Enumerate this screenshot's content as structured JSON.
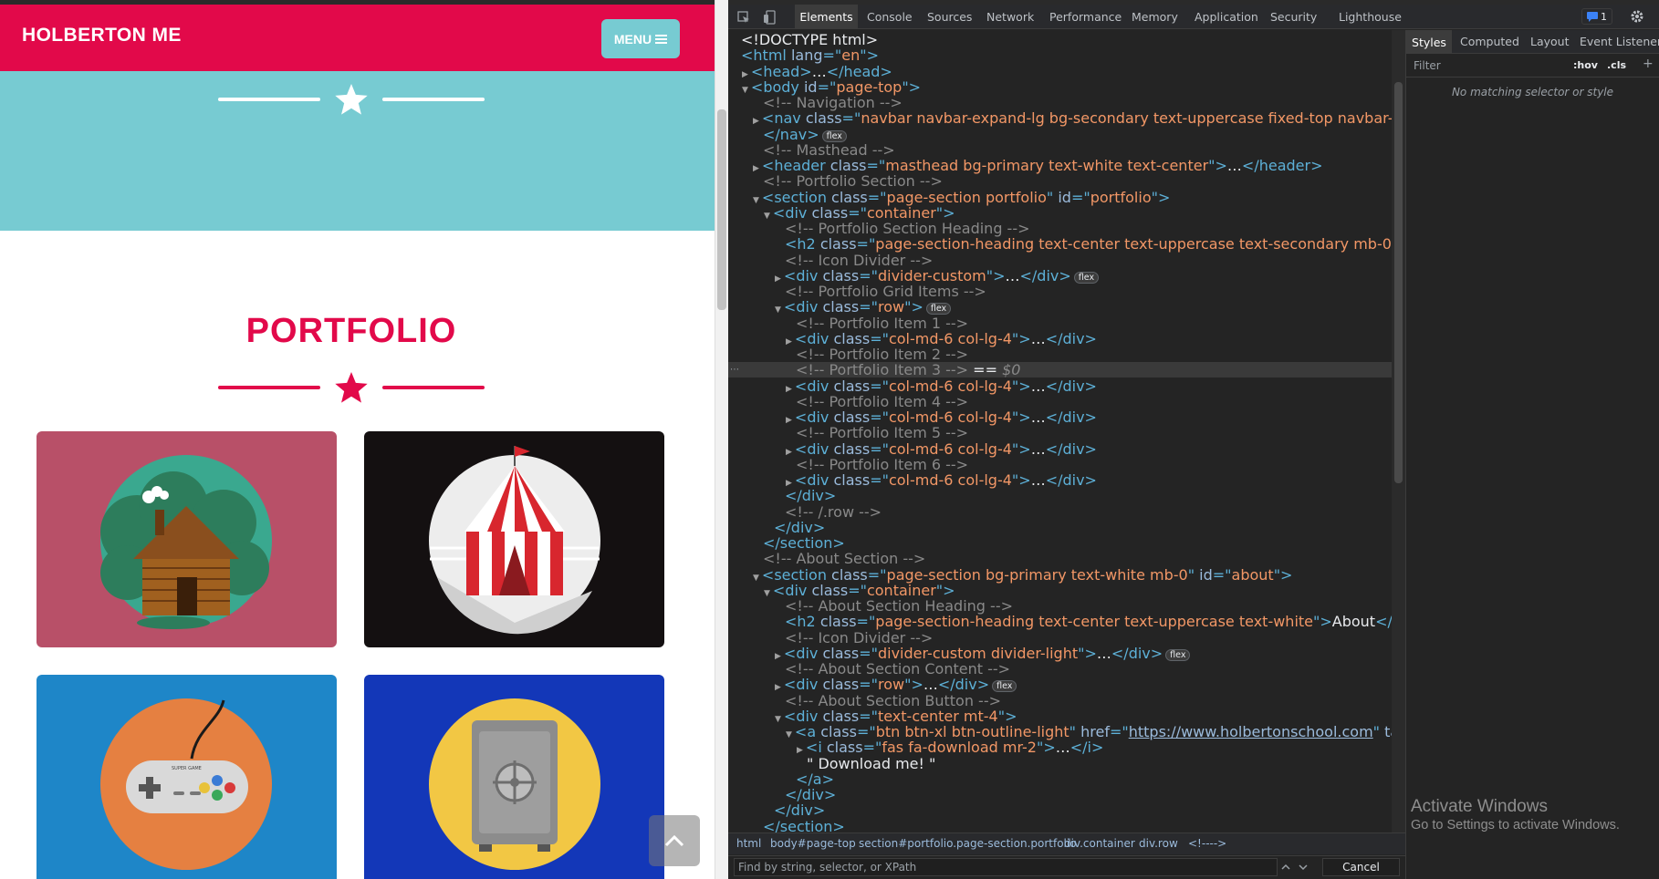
{
  "site": {
    "brand": "HOLBERTON ME",
    "menu_label": "MENU",
    "portfolio_heading": "PORTFOLIO",
    "colors": {
      "primary": "#e2094a",
      "secondary": "#77cbd2"
    },
    "tiles": [
      {
        "name": "cabin",
        "bg": "#b85068",
        "circle": "#3aa88f"
      },
      {
        "name": "circus-tent",
        "bg": "#141011",
        "circle": "#ededed"
      },
      {
        "name": "game-controller",
        "bg": "#1e86c8",
        "circle": "#e58041"
      },
      {
        "name": "safe",
        "bg": "#1337b8",
        "circle": "#f2c744"
      }
    ],
    "controller_text": "SUPER GAME"
  },
  "devtools": {
    "tabs": [
      "Elements",
      "Console",
      "Sources",
      "Network",
      "Performance",
      "Memory",
      "Application",
      "Security",
      "Lighthouse"
    ],
    "issues_count": "1",
    "code_lines": [
      [
        {
          "c": "t-txt",
          "t": "<!DOCTYPE html>"
        }
      ],
      [
        {
          "c": "t-tag",
          "t": "<html "
        },
        {
          "c": "t-attr",
          "t": "lang"
        },
        {
          "c": "t-tag",
          "t": "=\""
        },
        {
          "c": "t-val",
          "t": "en"
        },
        {
          "c": "t-tag",
          "t": "\">"
        }
      ],
      [
        {
          "c": "tri",
          "t": "▶"
        },
        {
          "c": "t-tag",
          "t": "<head>"
        },
        {
          "c": "t-txt",
          "t": "…"
        },
        {
          "c": "t-tag",
          "t": "</head>"
        }
      ],
      [
        {
          "c": "tri",
          "t": "▼"
        },
        {
          "c": "t-tag",
          "t": "<body "
        },
        {
          "c": "t-attr",
          "t": "id"
        },
        {
          "c": "t-tag",
          "t": "=\""
        },
        {
          "c": "t-val",
          "t": "page-top"
        },
        {
          "c": "t-tag",
          "t": "\">"
        }
      ],
      [
        {
          "c": "t-cmt",
          "t": "<!-- Navigation -->"
        }
      ],
      [
        {
          "c": "tri",
          "t": "▶"
        },
        {
          "c": "t-tag",
          "t": "<nav "
        },
        {
          "c": "t-attr",
          "t": "class"
        },
        {
          "c": "t-tag",
          "t": "=\""
        },
        {
          "c": "t-val",
          "t": "navbar navbar-expand-lg bg-secondary text-uppercase fixed-top navbar-shrink"
        },
        {
          "c": "t-tag",
          "t": "\" "
        },
        {
          "c": "t-attr",
          "t": "id"
        },
        {
          "c": "t-tag",
          "t": "=\""
        },
        {
          "c": "t-val",
          "t": "mainNav"
        },
        {
          "c": "t-tag",
          "t": "\">"
        },
        {
          "c": "t-txt",
          "t": "…"
        }
      ],
      [
        {
          "c": "t-tag",
          "t": "</nav>"
        },
        {
          "c": "pill",
          "t": "flex"
        }
      ],
      [
        {
          "c": "t-cmt",
          "t": "<!-- Masthead -->"
        }
      ],
      [
        {
          "c": "tri",
          "t": "▶"
        },
        {
          "c": "t-tag",
          "t": "<header "
        },
        {
          "c": "t-attr",
          "t": "class"
        },
        {
          "c": "t-tag",
          "t": "=\""
        },
        {
          "c": "t-val",
          "t": "masthead bg-primary text-white text-center"
        },
        {
          "c": "t-tag",
          "t": "\">"
        },
        {
          "c": "t-txt",
          "t": "…"
        },
        {
          "c": "t-tag",
          "t": "</header>"
        }
      ],
      [
        {
          "c": "t-cmt",
          "t": "<!-- Portfolio Section -->"
        }
      ],
      [
        {
          "c": "tri",
          "t": "▼"
        },
        {
          "c": "t-tag",
          "t": "<section "
        },
        {
          "c": "t-attr",
          "t": "class"
        },
        {
          "c": "t-tag",
          "t": "=\""
        },
        {
          "c": "t-val",
          "t": "page-section portfolio"
        },
        {
          "c": "t-tag",
          "t": "\" "
        },
        {
          "c": "t-attr",
          "t": "id"
        },
        {
          "c": "t-tag",
          "t": "=\""
        },
        {
          "c": "t-val",
          "t": "portfolio"
        },
        {
          "c": "t-tag",
          "t": "\">"
        }
      ],
      [
        {
          "c": "tri",
          "t": "▼"
        },
        {
          "c": "t-tag",
          "t": "<div "
        },
        {
          "c": "t-attr",
          "t": "class"
        },
        {
          "c": "t-tag",
          "t": "=\""
        },
        {
          "c": "t-val",
          "t": "container"
        },
        {
          "c": "t-tag",
          "t": "\">"
        }
      ],
      [
        {
          "c": "t-cmt",
          "t": "<!-- Portfolio Section Heading -->"
        }
      ],
      [
        {
          "c": "t-tag",
          "t": "<h2 "
        },
        {
          "c": "t-attr",
          "t": "class"
        },
        {
          "c": "t-tag",
          "t": "=\""
        },
        {
          "c": "t-val",
          "t": "page-section-heading text-center text-uppercase text-secondary mb-0"
        },
        {
          "c": "t-tag",
          "t": "\">"
        },
        {
          "c": "t-txt",
          "t": "Portfolio"
        },
        {
          "c": "t-tag",
          "t": "</h2>"
        }
      ],
      [
        {
          "c": "t-cmt",
          "t": "<!-- Icon Divider -->"
        }
      ],
      [
        {
          "c": "tri",
          "t": "▶"
        },
        {
          "c": "t-tag",
          "t": "<div "
        },
        {
          "c": "t-attr",
          "t": "class"
        },
        {
          "c": "t-tag",
          "t": "=\""
        },
        {
          "c": "t-val",
          "t": "divider-custom"
        },
        {
          "c": "t-tag",
          "t": "\">"
        },
        {
          "c": "t-txt",
          "t": "…"
        },
        {
          "c": "t-tag",
          "t": "</div>"
        },
        {
          "c": "pill",
          "t": "flex"
        }
      ],
      [
        {
          "c": "t-cmt",
          "t": "<!-- Portfolio Grid Items -->"
        }
      ],
      [
        {
          "c": "tri",
          "t": "▼"
        },
        {
          "c": "t-tag",
          "t": "<div "
        },
        {
          "c": "t-attr",
          "t": "class"
        },
        {
          "c": "t-tag",
          "t": "=\""
        },
        {
          "c": "t-val",
          "t": "row"
        },
        {
          "c": "t-tag",
          "t": "\">"
        },
        {
          "c": "pill",
          "t": "flex"
        }
      ],
      [
        {
          "c": "t-cmt",
          "t": "<!-- Portfolio Item 1 -->"
        }
      ],
      [
        {
          "c": "tri",
          "t": "▶"
        },
        {
          "c": "t-tag",
          "t": "<div "
        },
        {
          "c": "t-attr",
          "t": "class"
        },
        {
          "c": "t-tag",
          "t": "=\""
        },
        {
          "c": "t-val",
          "t": "col-md-6 col-lg-4"
        },
        {
          "c": "t-tag",
          "t": "\">"
        },
        {
          "c": "t-txt",
          "t": "…"
        },
        {
          "c": "t-tag",
          "t": "</div>"
        }
      ],
      [
        {
          "c": "t-cmt",
          "t": "<!-- Portfolio Item 2 -->"
        }
      ],
      [
        {
          "c": "t-cmt",
          "t": "<!-- Portfolio Item 3 -->"
        },
        {
          "c": "t-txt",
          "t": " == "
        },
        {
          "c": "t-dim",
          "t": "$0"
        }
      ],
      [
        {
          "c": "tri",
          "t": "▶"
        },
        {
          "c": "t-tag",
          "t": "<div "
        },
        {
          "c": "t-attr",
          "t": "class"
        },
        {
          "c": "t-tag",
          "t": "=\""
        },
        {
          "c": "t-val",
          "t": "col-md-6 col-lg-4"
        },
        {
          "c": "t-tag",
          "t": "\">"
        },
        {
          "c": "t-txt",
          "t": "…"
        },
        {
          "c": "t-tag",
          "t": "</div>"
        }
      ],
      [
        {
          "c": "t-cmt",
          "t": "<!-- Portfolio Item 4 -->"
        }
      ],
      [
        {
          "c": "tri",
          "t": "▶"
        },
        {
          "c": "t-tag",
          "t": "<div "
        },
        {
          "c": "t-attr",
          "t": "class"
        },
        {
          "c": "t-tag",
          "t": "=\""
        },
        {
          "c": "t-val",
          "t": "col-md-6 col-lg-4"
        },
        {
          "c": "t-tag",
          "t": "\">"
        },
        {
          "c": "t-txt",
          "t": "…"
        },
        {
          "c": "t-tag",
          "t": "</div>"
        }
      ],
      [
        {
          "c": "t-cmt",
          "t": "<!-- Portfolio Item 5 -->"
        }
      ],
      [
        {
          "c": "tri",
          "t": "▶"
        },
        {
          "c": "t-tag",
          "t": "<div "
        },
        {
          "c": "t-attr",
          "t": "class"
        },
        {
          "c": "t-tag",
          "t": "=\""
        },
        {
          "c": "t-val",
          "t": "col-md-6 col-lg-4"
        },
        {
          "c": "t-tag",
          "t": "\">"
        },
        {
          "c": "t-txt",
          "t": "…"
        },
        {
          "c": "t-tag",
          "t": "</div>"
        }
      ],
      [
        {
          "c": "t-cmt",
          "t": "<!-- Portfolio Item 6 -->"
        }
      ],
      [
        {
          "c": "tri",
          "t": "▶"
        },
        {
          "c": "t-tag",
          "t": "<div "
        },
        {
          "c": "t-attr",
          "t": "class"
        },
        {
          "c": "t-tag",
          "t": "=\""
        },
        {
          "c": "t-val",
          "t": "col-md-6 col-lg-4"
        },
        {
          "c": "t-tag",
          "t": "\">"
        },
        {
          "c": "t-txt",
          "t": "…"
        },
        {
          "c": "t-tag",
          "t": "</div>"
        }
      ],
      [
        {
          "c": "t-tag",
          "t": "</div>"
        }
      ],
      [
        {
          "c": "t-cmt",
          "t": "<!-- /.row -->"
        }
      ],
      [
        {
          "c": "t-tag",
          "t": "</div>"
        }
      ],
      [
        {
          "c": "t-tag",
          "t": "</section>"
        }
      ],
      [
        {
          "c": "t-cmt",
          "t": "<!-- About Section -->"
        }
      ],
      [
        {
          "c": "tri",
          "t": "▼"
        },
        {
          "c": "t-tag",
          "t": "<section "
        },
        {
          "c": "t-attr",
          "t": "class"
        },
        {
          "c": "t-tag",
          "t": "=\""
        },
        {
          "c": "t-val",
          "t": "page-section bg-primary text-white mb-0"
        },
        {
          "c": "t-tag",
          "t": "\" "
        },
        {
          "c": "t-attr",
          "t": "id"
        },
        {
          "c": "t-tag",
          "t": "=\""
        },
        {
          "c": "t-val",
          "t": "about"
        },
        {
          "c": "t-tag",
          "t": "\">"
        }
      ],
      [
        {
          "c": "tri",
          "t": "▼"
        },
        {
          "c": "t-tag",
          "t": "<div "
        },
        {
          "c": "t-attr",
          "t": "class"
        },
        {
          "c": "t-tag",
          "t": "=\""
        },
        {
          "c": "t-val",
          "t": "container"
        },
        {
          "c": "t-tag",
          "t": "\">"
        }
      ],
      [
        {
          "c": "t-cmt",
          "t": "<!-- About Section Heading -->"
        }
      ],
      [
        {
          "c": "t-tag",
          "t": "<h2 "
        },
        {
          "c": "t-attr",
          "t": "class"
        },
        {
          "c": "t-tag",
          "t": "=\""
        },
        {
          "c": "t-val",
          "t": "page-section-heading text-center text-uppercase text-white"
        },
        {
          "c": "t-tag",
          "t": "\">"
        },
        {
          "c": "t-txt",
          "t": "About"
        },
        {
          "c": "t-tag",
          "t": "</h2>"
        }
      ],
      [
        {
          "c": "t-cmt",
          "t": "<!-- Icon Divider -->"
        }
      ],
      [
        {
          "c": "tri",
          "t": "▶"
        },
        {
          "c": "t-tag",
          "t": "<div "
        },
        {
          "c": "t-attr",
          "t": "class"
        },
        {
          "c": "t-tag",
          "t": "=\""
        },
        {
          "c": "t-val",
          "t": "divider-custom divider-light"
        },
        {
          "c": "t-tag",
          "t": "\">"
        },
        {
          "c": "t-txt",
          "t": "…"
        },
        {
          "c": "t-tag",
          "t": "</div>"
        },
        {
          "c": "pill",
          "t": "flex"
        }
      ],
      [
        {
          "c": "t-cmt",
          "t": "<!-- About Section Content -->"
        }
      ],
      [
        {
          "c": "tri",
          "t": "▶"
        },
        {
          "c": "t-tag",
          "t": "<div "
        },
        {
          "c": "t-attr",
          "t": "class"
        },
        {
          "c": "t-tag",
          "t": "=\""
        },
        {
          "c": "t-val",
          "t": "row"
        },
        {
          "c": "t-tag",
          "t": "\">"
        },
        {
          "c": "t-txt",
          "t": "…"
        },
        {
          "c": "t-tag",
          "t": "</div>"
        },
        {
          "c": "pill",
          "t": "flex"
        }
      ],
      [
        {
          "c": "t-cmt",
          "t": "<!-- About Section Button -->"
        }
      ],
      [
        {
          "c": "tri",
          "t": "▼"
        },
        {
          "c": "t-tag",
          "t": "<div "
        },
        {
          "c": "t-attr",
          "t": "class"
        },
        {
          "c": "t-tag",
          "t": "=\""
        },
        {
          "c": "t-val",
          "t": "text-center mt-4"
        },
        {
          "c": "t-tag",
          "t": "\">"
        }
      ],
      [
        {
          "c": "tri",
          "t": "▼"
        },
        {
          "c": "t-tag",
          "t": "<a "
        },
        {
          "c": "t-attr",
          "t": "class"
        },
        {
          "c": "t-tag",
          "t": "=\""
        },
        {
          "c": "t-val",
          "t": "btn btn-xl btn-outline-light"
        },
        {
          "c": "t-tag",
          "t": "\" "
        },
        {
          "c": "t-attr",
          "t": "href"
        },
        {
          "c": "t-tag",
          "t": "=\""
        },
        {
          "c": "t-link",
          "t": "https://www.holbertonschool.com"
        },
        {
          "c": "t-tag",
          "t": "\" "
        },
        {
          "c": "t-attr",
          "t": "target"
        },
        {
          "c": "t-tag",
          "t": "=\""
        },
        {
          "c": "t-val",
          "t": "_blank"
        },
        {
          "c": "t-tag",
          "t": "\">"
        }
      ],
      [
        {
          "c": "tri",
          "t": "▶"
        },
        {
          "c": "t-tag",
          "t": "<i "
        },
        {
          "c": "t-attr",
          "t": "class"
        },
        {
          "c": "t-tag",
          "t": "=\""
        },
        {
          "c": "t-val",
          "t": "fas fa-download mr-2"
        },
        {
          "c": "t-tag",
          "t": "\">"
        },
        {
          "c": "t-txt",
          "t": "…"
        },
        {
          "c": "t-tag",
          "t": "</i>"
        }
      ],
      [
        {
          "c": "t-txt",
          "t": "\" Download me! \""
        }
      ],
      [
        {
          "c": "t-tag",
          "t": "</a>"
        }
      ],
      [
        {
          "c": "t-tag",
          "t": "</div>"
        }
      ],
      [
        {
          "c": "t-tag",
          "t": "</div>"
        }
      ],
      [
        {
          "c": "t-tag",
          "t": "</section>"
        }
      ]
    ],
    "indents": [
      0,
      0,
      1,
      1,
      2,
      2,
      2,
      2,
      2,
      2,
      2,
      3,
      4,
      4,
      4,
      4,
      4,
      4,
      5,
      5,
      5,
      5,
      5,
      5,
      5,
      5,
      5,
      5,
      5,
      4,
      4,
      3,
      2,
      2,
      2,
      3,
      4,
      4,
      4,
      4,
      4,
      4,
      4,
      4,
      5,
      6,
      6,
      5,
      4,
      3,
      2
    ],
    "breadcrumbs": [
      "html",
      "body#page-top",
      "section#portfolio.page-section.portfolio",
      "div.container",
      "div.row",
      "<!---->"
    ],
    "find_placeholder": "Find by string, selector, or XPath",
    "cancel_label": "Cancel",
    "styles_tabs": [
      "Styles",
      "Computed",
      "Layout",
      "Event Listeners"
    ],
    "filter_placeholder": "Filter",
    "hov_label": ":hov",
    "cls_label": ".cls",
    "no_match": "No matching selector or style",
    "activate_title": "Activate Windows",
    "activate_sub": "Go to Settings to activate Windows."
  }
}
